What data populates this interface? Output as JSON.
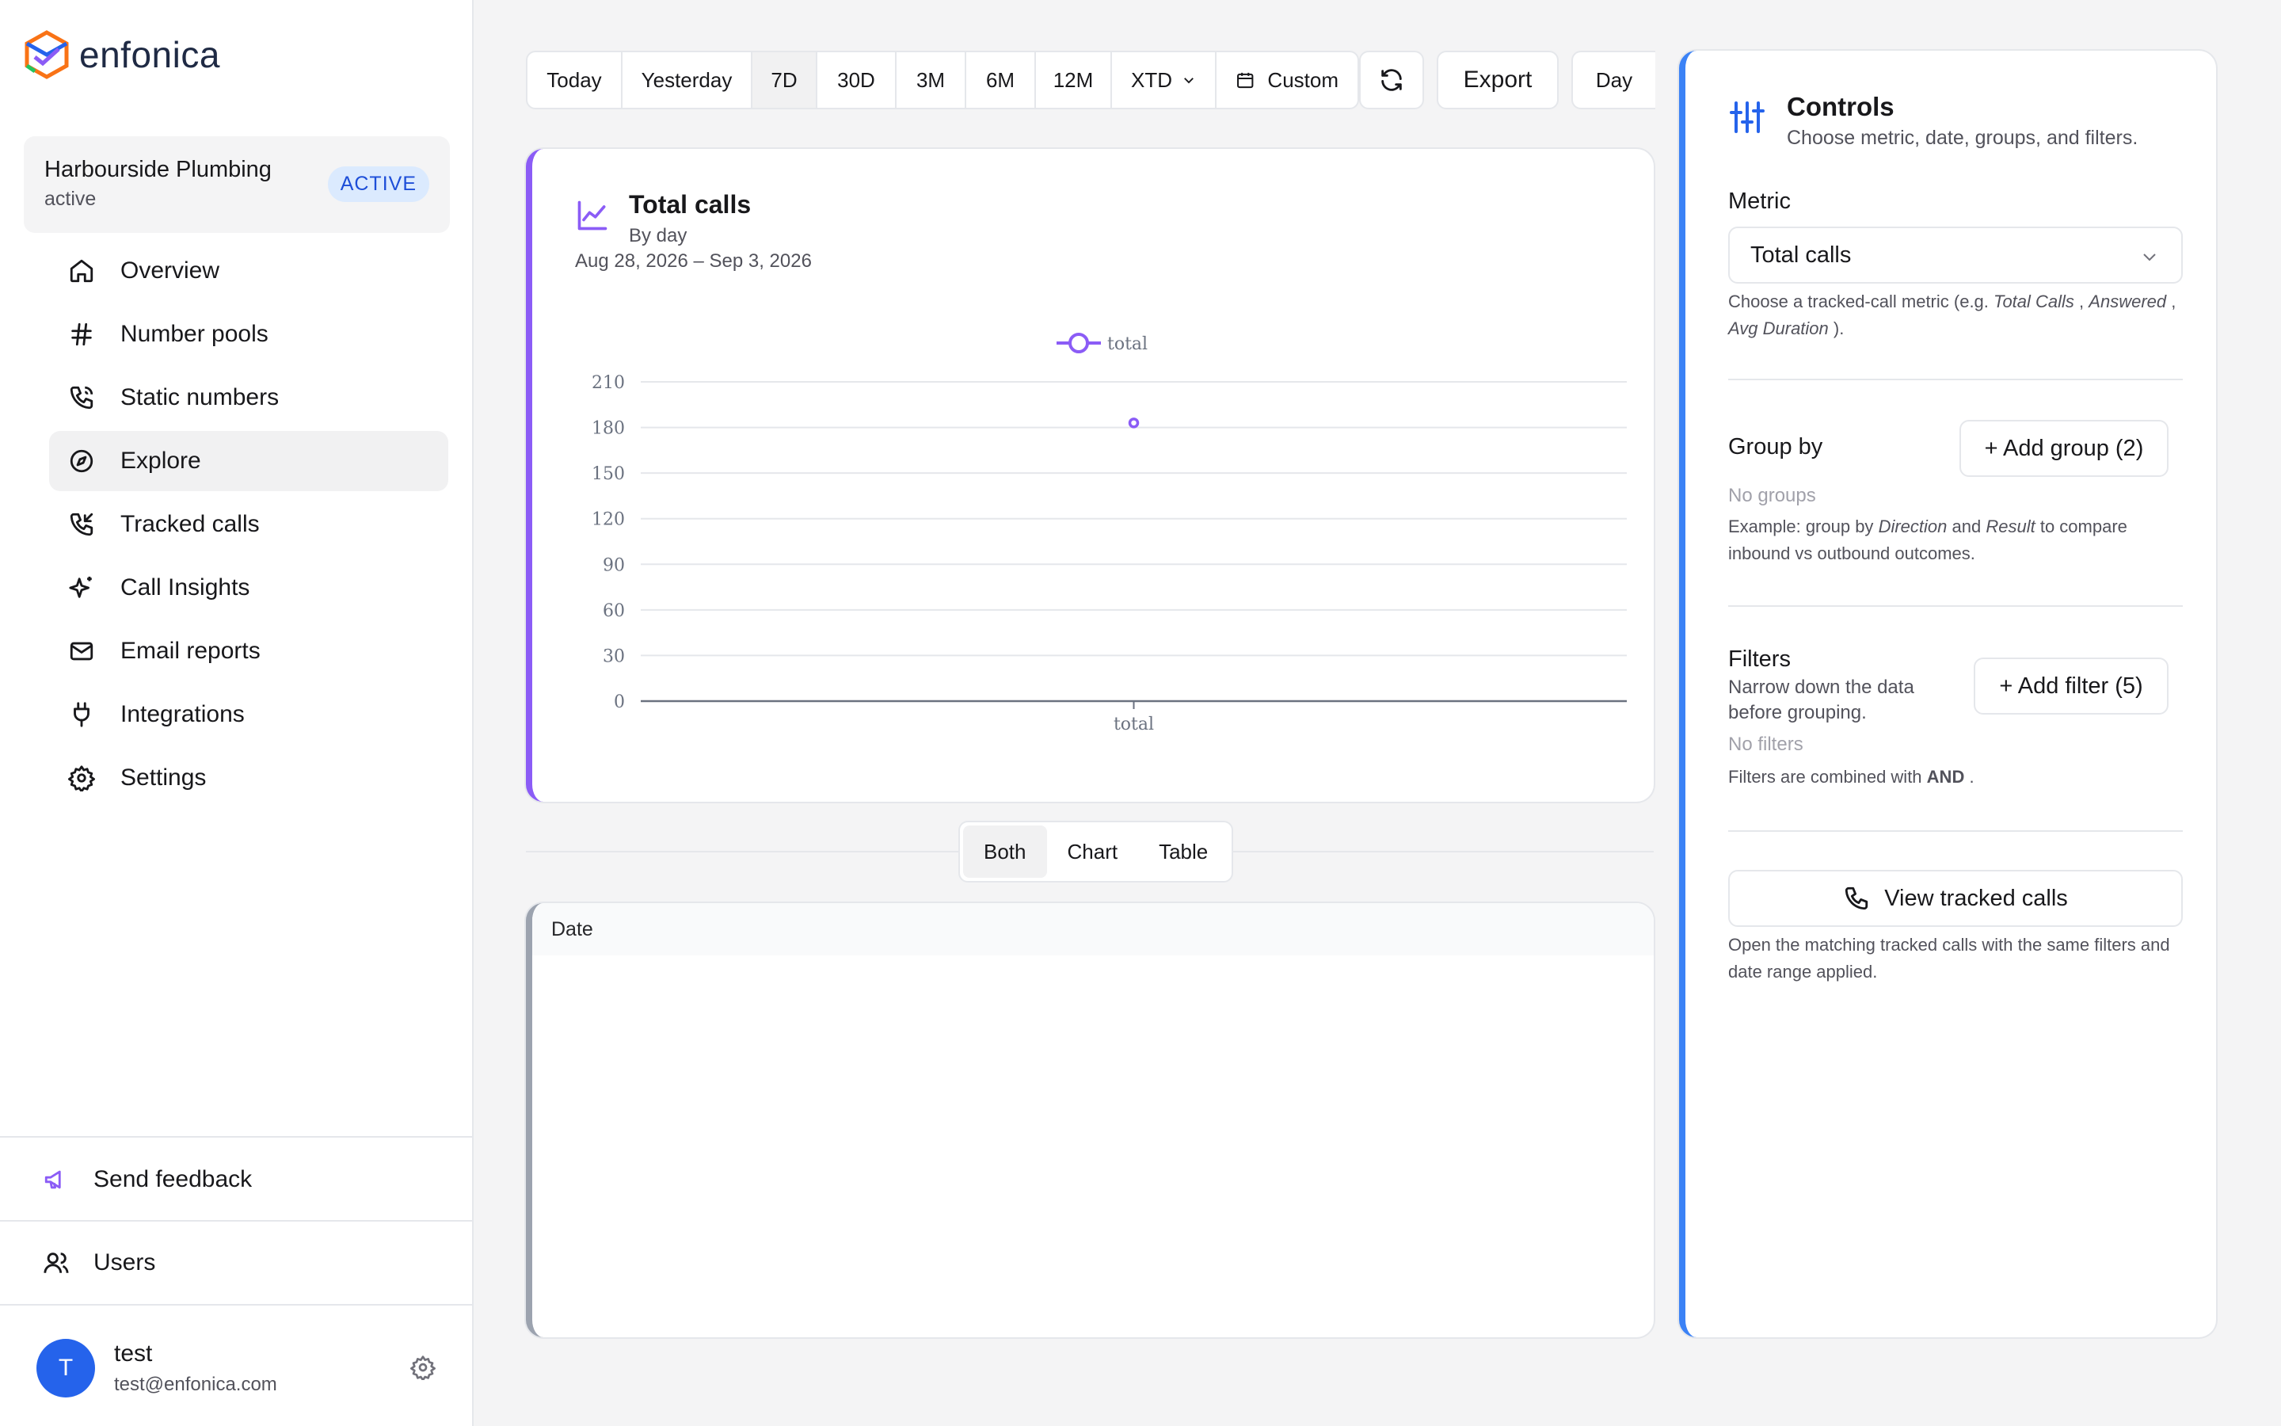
{
  "app": {
    "brand": "enfonica"
  },
  "account": {
    "name": "Harbourside Plumbing",
    "status": "active",
    "badge": "ACTIVE"
  },
  "nav": [
    {
      "label": "Overview",
      "icon": "home-icon"
    },
    {
      "label": "Number pools",
      "icon": "hash-icon"
    },
    {
      "label": "Static numbers",
      "icon": "phone-icon"
    },
    {
      "label": "Explore",
      "icon": "compass-icon",
      "active": true
    },
    {
      "label": "Tracked calls",
      "icon": "phone-incoming-icon"
    },
    {
      "label": "Call Insights",
      "icon": "sparkles-icon"
    },
    {
      "label": "Email reports",
      "icon": "mail-icon"
    },
    {
      "label": "Integrations",
      "icon": "plug-icon"
    },
    {
      "label": "Settings",
      "icon": "gear-icon"
    }
  ],
  "sidebar_bottom": {
    "feedback": "Send feedback",
    "users": "Users"
  },
  "user": {
    "initial": "T",
    "name": "test",
    "email": "test@enfonica.com"
  },
  "toolbar": {
    "ranges": [
      "Today",
      "Yesterday",
      "7D",
      "30D",
      "3M",
      "6M",
      "12M",
      "XTD"
    ],
    "selected_range": "7D",
    "custom": "Custom",
    "export": "Export",
    "granularity": "Day"
  },
  "chart_card": {
    "title": "Total calls",
    "subtitle": "By day",
    "date_range": "Aug 28, 2026 – Sep 3, 2026"
  },
  "chart_data": {
    "type": "scatter",
    "legend": [
      "total"
    ],
    "legend_position": "top-center",
    "categories": [
      "total"
    ],
    "series": [
      {
        "name": "total",
        "values": [
          183
        ]
      }
    ],
    "yticks": [
      "210",
      "180",
      "150",
      "120",
      "90",
      "60",
      "30",
      "0"
    ],
    "ylim": [
      0,
      210
    ],
    "grid": true,
    "color": "#8b5cf6"
  },
  "view_toggle": {
    "options": [
      "Both",
      "Chart",
      "Table"
    ],
    "selected": "Both"
  },
  "table": {
    "columns": [
      "Date"
    ]
  },
  "controls": {
    "title": "Controls",
    "subtitle": "Choose metric, date, groups, and filters.",
    "metric_label": "Metric",
    "metric_value": "Total calls",
    "metric_help_prefix": "Choose a tracked-call metric (e.g.",
    "metric_help_ex1": "Total Calls",
    "metric_help_ex2": "Answered",
    "metric_help_ex3": "Avg Duration",
    "group_label": "Group by",
    "add_group": "+ Add group (2)",
    "no_groups": "No groups",
    "group_help_prefix": "Example: group by",
    "group_help_a": "Direction",
    "group_help_and": "and",
    "group_help_b": "Result",
    "group_help_suffix": "to compare inbound vs outbound outcomes.",
    "filters_label": "Filters",
    "filters_desc": "Narrow down the data before grouping.",
    "add_filter": "+ Add filter (5)",
    "no_filters": "No filters",
    "filters_help_prefix": "Filters are combined with",
    "filters_help_and": "AND",
    "view_calls": "View tracked calls",
    "view_calls_help": "Open the matching tracked calls with the same filters and date range applied."
  }
}
